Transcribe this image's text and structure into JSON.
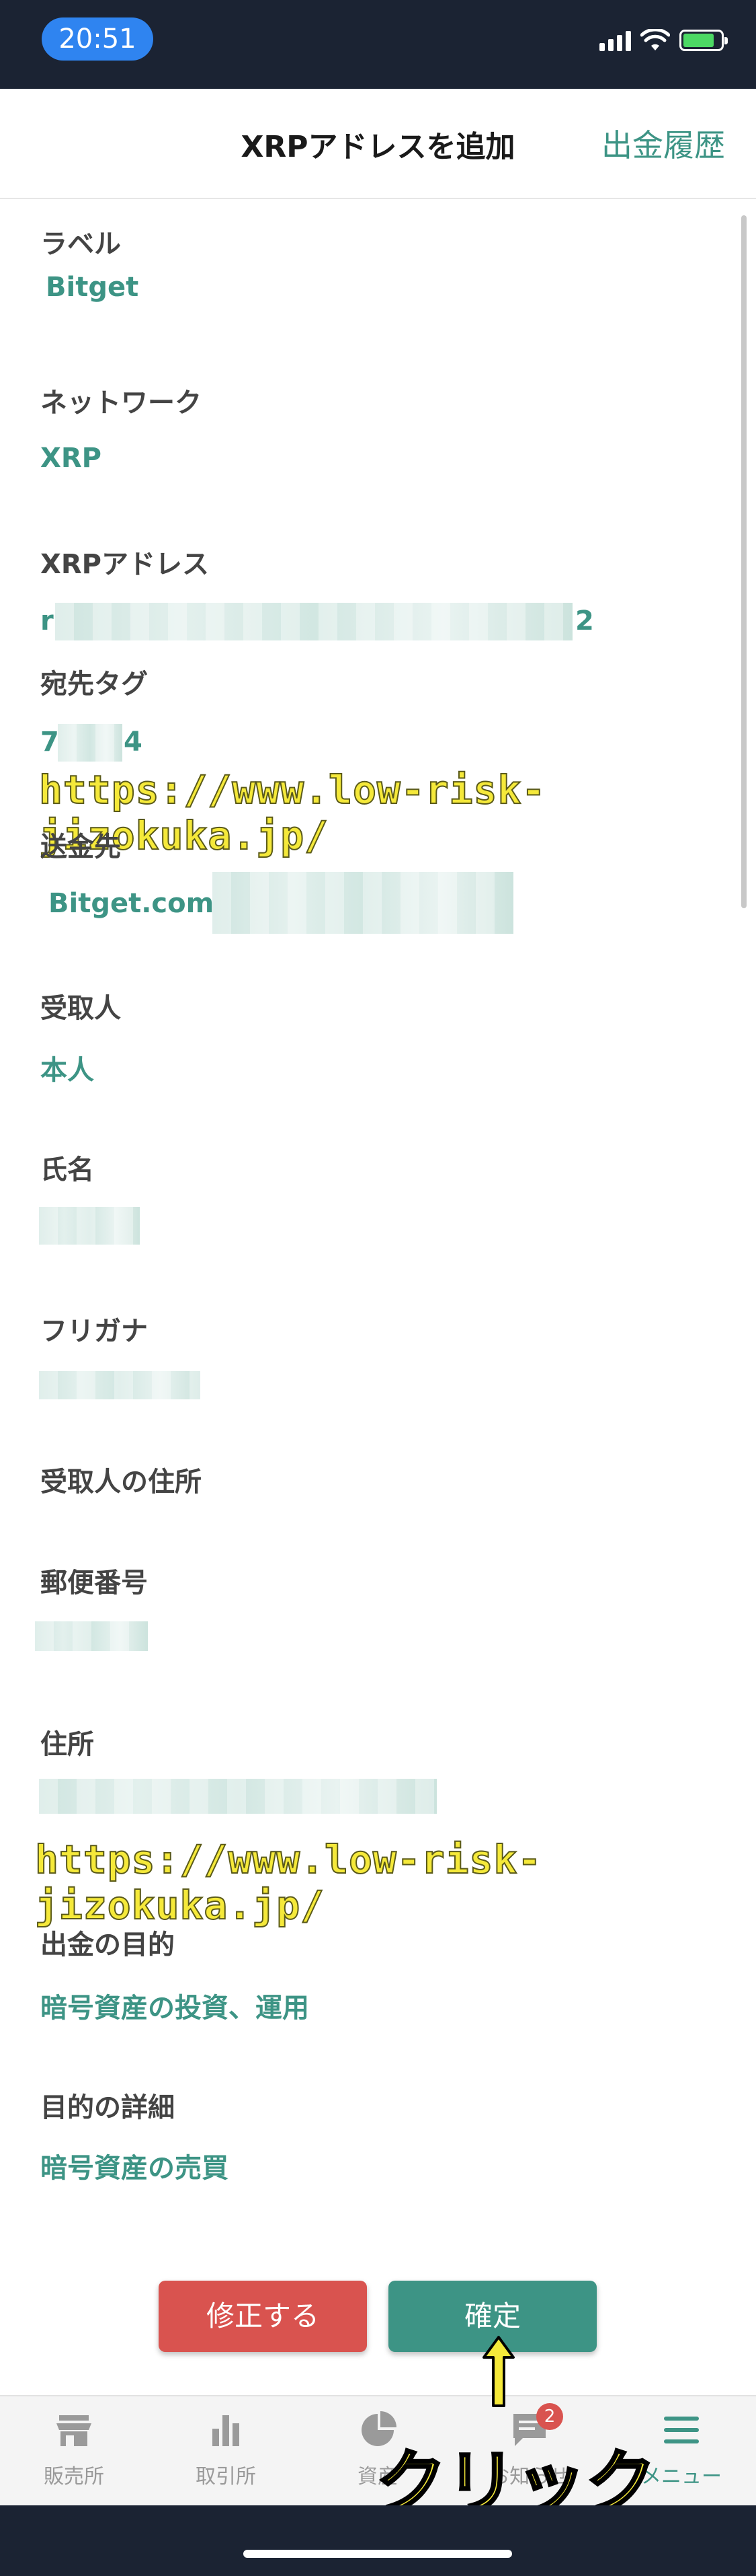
{
  "status_bar": {
    "time": "20:51"
  },
  "header": {
    "title": "XRPアドレスを追加",
    "history_link": "出金履歴"
  },
  "fields": {
    "label": {
      "label": "ラベル",
      "value": "Bitget"
    },
    "network": {
      "label": "ネットワーク",
      "value": "XRP"
    },
    "address": {
      "label": "XRPアドレス",
      "value_start": "r",
      "value_end": "2"
    },
    "dest_tag": {
      "label": "宛先タグ",
      "value_start": "7",
      "value_end": "4"
    },
    "destination": {
      "label": "送金先",
      "value": "Bitget.com"
    },
    "recipient": {
      "label": "受取人",
      "value": "本人"
    },
    "name": {
      "label": "氏名"
    },
    "furigana": {
      "label": "フリガナ"
    },
    "recipient_address": {
      "label": "受取人の住所"
    },
    "postal_code": {
      "label": "郵便番号"
    },
    "street": {
      "label": "住所"
    },
    "purpose": {
      "label": "出金の目的",
      "value": "暗号資産の投資、運用"
    },
    "purpose_detail": {
      "label": "目的の詳細",
      "value": "暗号資産の売買"
    }
  },
  "watermark": "https://www.low-risk-jizokuka.jp/",
  "buttons": {
    "edit": "修正する",
    "confirm": "確定"
  },
  "annotation": {
    "click": "クリック"
  },
  "tabbar": [
    {
      "label": "販売所",
      "icon": "store-icon"
    },
    {
      "label": "取引所",
      "icon": "bar-chart-icon"
    },
    {
      "label": "資産",
      "icon": "pie-chart-icon"
    },
    {
      "label": "お知らせ",
      "icon": "message-icon",
      "badge": "2"
    },
    {
      "label": "メニュー",
      "icon": "menu-icon"
    }
  ],
  "colors": {
    "accent": "#3d9485",
    "danger": "#d9534f",
    "status_bar": "#1b2333",
    "time_pill": "#2f84f0"
  }
}
